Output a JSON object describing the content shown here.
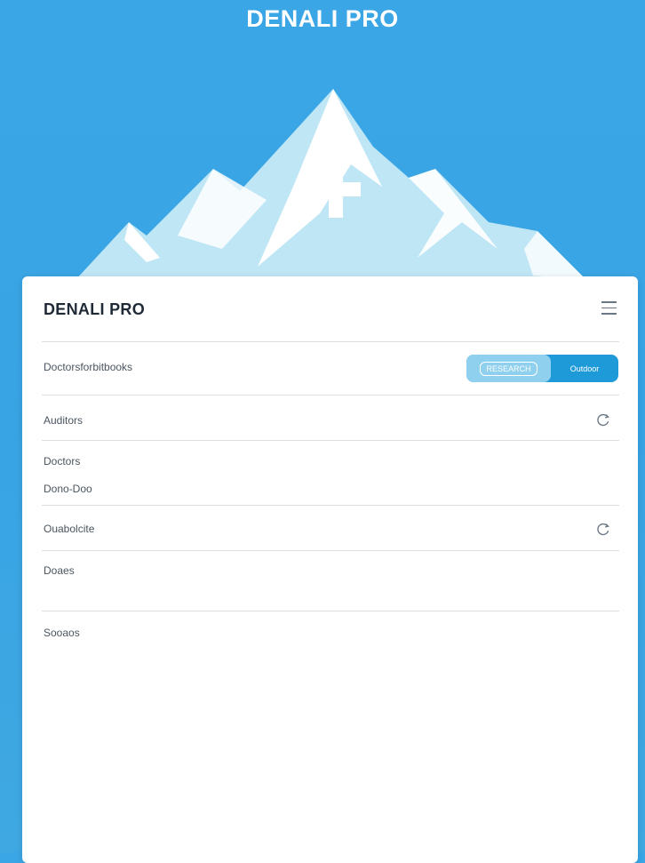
{
  "app": {
    "brand_title": "DENALI PRO"
  },
  "card": {
    "title": "DENALI PRO",
    "menu_icon": "hamburger-menu-icon",
    "rows": {
      "r1_label": "Doctorsforbitbooks",
      "toggle": {
        "option_a": "RESEARCH",
        "option_b": "Outdoor"
      },
      "r2_label": "Auditors",
      "r3_label": "Doctors",
      "r3_sublabel": "Dono-Doo",
      "r4_label": "Ouabolcite",
      "r5_label": "Doaes",
      "r6_label": "Sooaos"
    },
    "refresh_icon": "refresh-icon"
  },
  "colors": {
    "background": "#3aa6e6",
    "accent": "#1f9ad8",
    "toggle_light": "#8fd0ee"
  }
}
